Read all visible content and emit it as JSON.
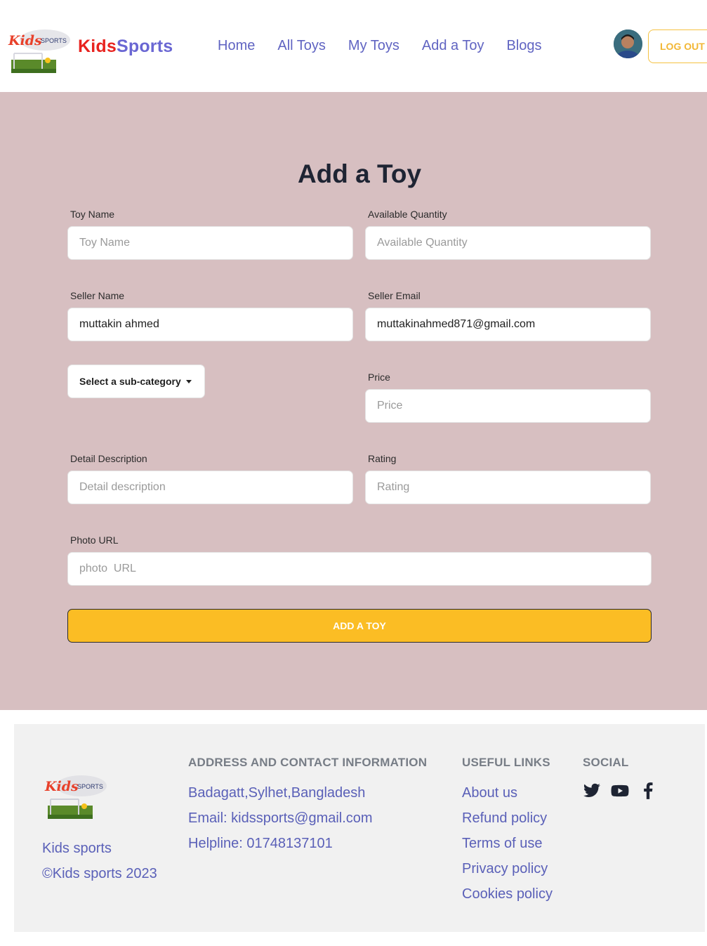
{
  "header": {
    "brand_kids": "Kids",
    "brand_sports": "Sports",
    "nav": [
      "Home",
      "All Toys",
      "My Toys",
      "Add a Toy",
      "Blogs"
    ],
    "logout_label": "LOG OUT"
  },
  "form": {
    "title": "Add a Toy",
    "toy_name": {
      "label": "Toy Name",
      "placeholder": "Toy Name",
      "value": ""
    },
    "available_quantity": {
      "label": "Available Quantity",
      "placeholder": "Available Quantity",
      "value": ""
    },
    "seller_name": {
      "label": "Seller Name",
      "placeholder": "",
      "value": "muttakin ahmed"
    },
    "seller_email": {
      "label": "Seller Email",
      "placeholder": "",
      "value": "muttakinahmed871@gmail.com"
    },
    "sub_category": {
      "selected": "Select a sub-category"
    },
    "price": {
      "label": "Price",
      "placeholder": "Price",
      "value": ""
    },
    "detail_description": {
      "label": "Detail Description",
      "placeholder": "Detail description",
      "value": ""
    },
    "rating": {
      "label": "Rating",
      "placeholder": "Rating",
      "value": ""
    },
    "photo_url": {
      "label": "Photo URL",
      "placeholder": "photo  URL",
      "value": ""
    },
    "submit_label": "ADD A TOY"
  },
  "footer": {
    "brand_name": "Kids sports",
    "copyright": "©Kids sports 2023",
    "address_heading": "ADDRESS AND CONTACT INFORMATION",
    "address": "Badagatt,Sylhet,Bangladesh",
    "email": "Email: kidssports@gmail.com",
    "helpline": "Helpline: 01748137101",
    "links_heading": "USEFUL LINKS",
    "links": [
      "About us",
      "Refund policy",
      "Terms of use",
      "Privacy policy",
      "Cookies policy"
    ],
    "social_heading": "SOCIAL",
    "social_icons": [
      "twitter-icon",
      "youtube-icon",
      "facebook-icon"
    ]
  },
  "colors": {
    "brand_red": "#e8231f",
    "brand_purple": "#6a67d3",
    "nav_link": "#6064c2",
    "accent_yellow": "#fbbd24",
    "form_bg": "#d7bfc1",
    "footer_bg": "#f1f1f1"
  }
}
